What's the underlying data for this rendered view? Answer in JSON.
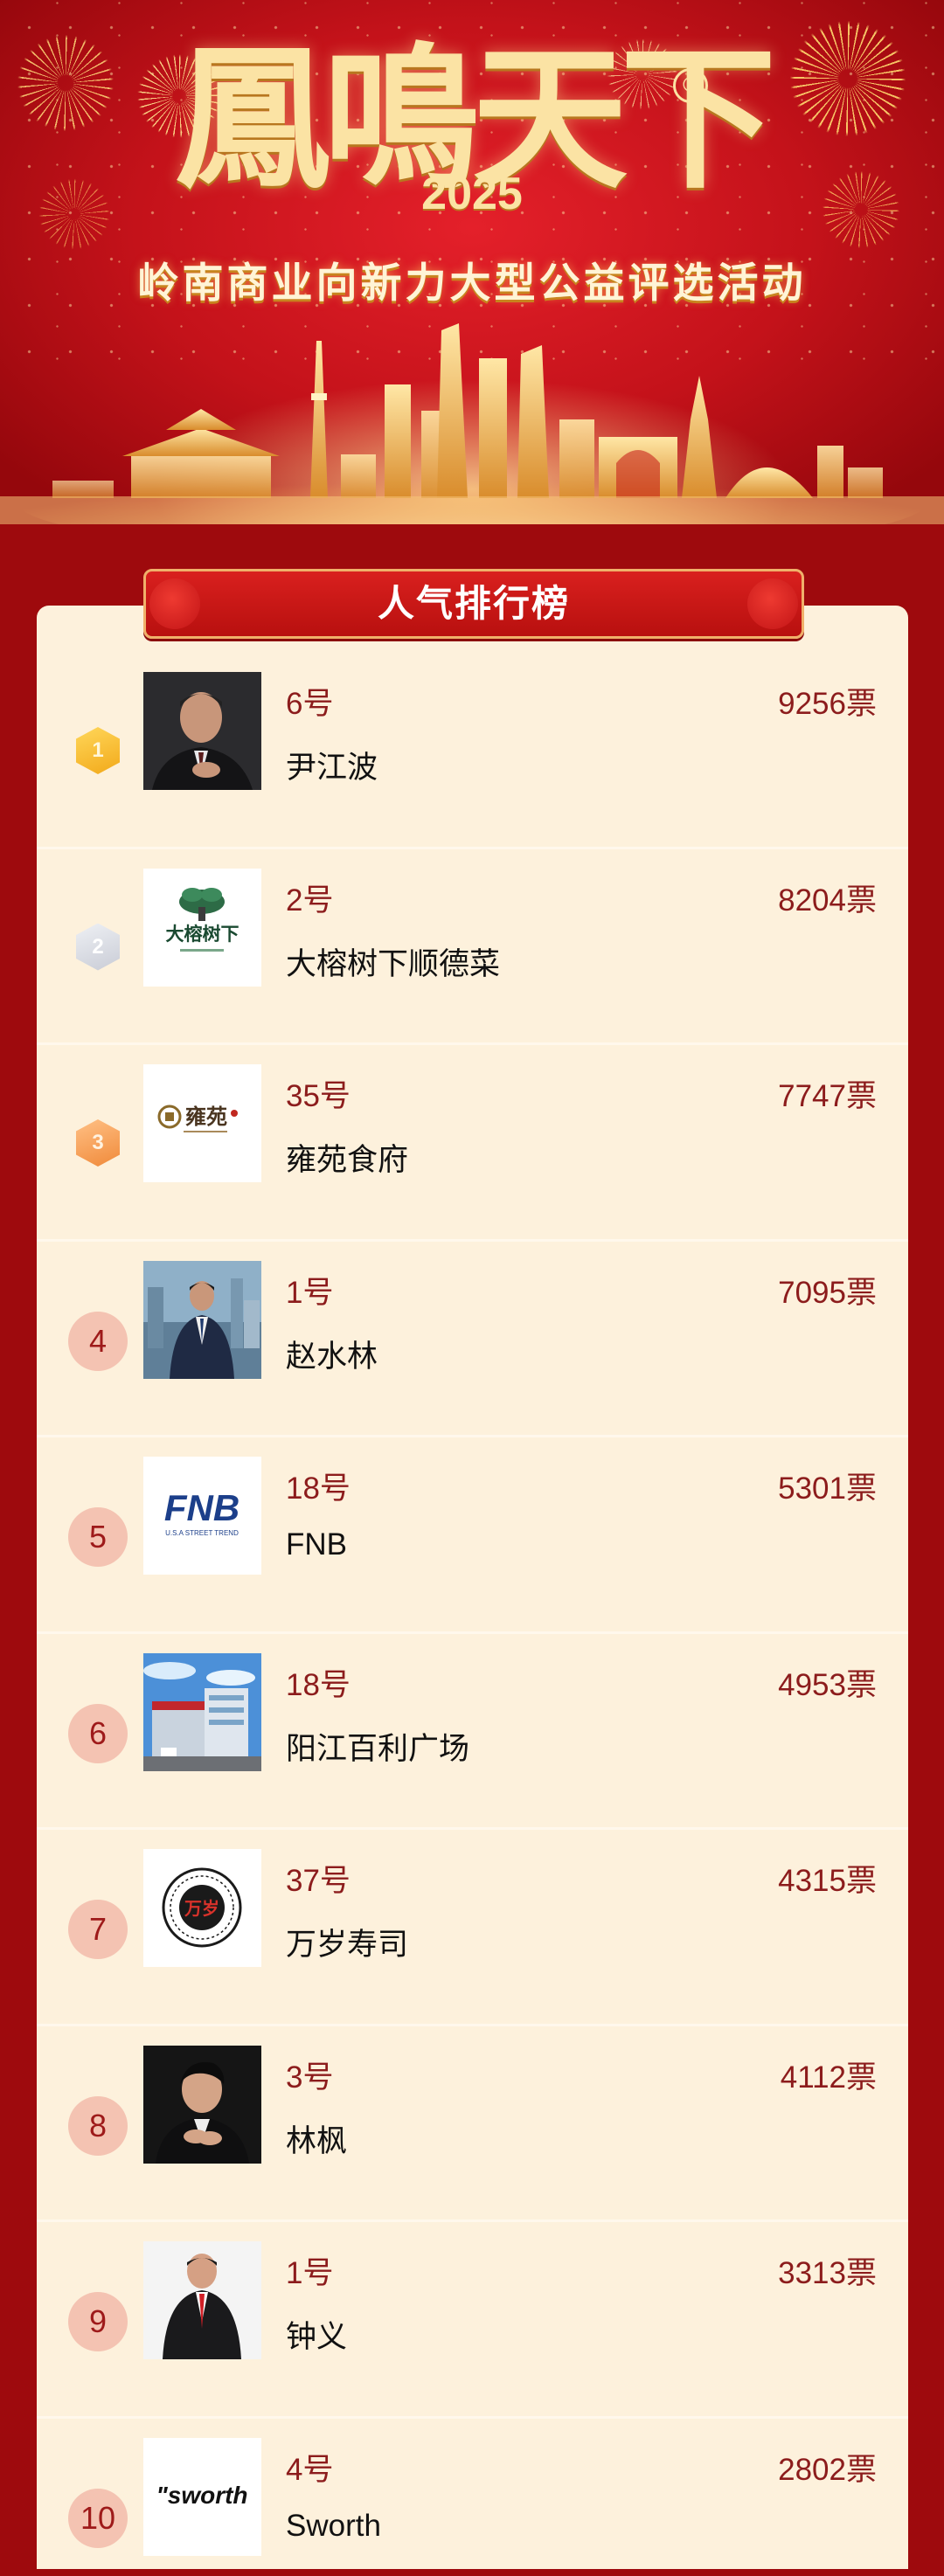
{
  "banner": {
    "logo_text": "鳳鳴天下",
    "registered_mark": "®",
    "year": "2025",
    "event_title": "岭南商业向新力大型公益评选活动"
  },
  "ranking": {
    "title": "人气排行榜",
    "entries": [
      {
        "rank": "1",
        "number": "6号",
        "name": "尹江波",
        "votes": "9256票"
      },
      {
        "rank": "2",
        "number": "2号",
        "name": "大榕树下顺德菜",
        "votes": "8204票"
      },
      {
        "rank": "3",
        "number": "35号",
        "name": "雍苑食府",
        "votes": "7747票"
      },
      {
        "rank": "4",
        "number": "1号",
        "name": "赵水林",
        "votes": "7095票"
      },
      {
        "rank": "5",
        "number": "18号",
        "name": "FNB",
        "votes": "5301票"
      },
      {
        "rank": "6",
        "number": "18号",
        "name": "阳江百利广场",
        "votes": "4953票"
      },
      {
        "rank": "7",
        "number": "37号",
        "name": "万岁寿司",
        "votes": "4315票"
      },
      {
        "rank": "8",
        "number": "3号",
        "name": "林枫",
        "votes": "4112票"
      },
      {
        "rank": "9",
        "number": "1号",
        "name": "钟义",
        "votes": "3313票"
      },
      {
        "rank": "10",
        "number": "4号",
        "name": "Sworth",
        "votes": "2802票"
      }
    ]
  },
  "logos": {
    "dashuxia_text": "大榕树下",
    "yongyuan_text": "雍苑",
    "fnb_text": "FNB",
    "fnb_sub": "U.S.A STREET TREND",
    "wansui_text": "万岁",
    "sworth_text": "\"sworth"
  },
  "colors": {
    "background": "#9e0a0d",
    "card": "#fdf1dc",
    "accent_red": "#8c1c1c",
    "gold": "#fbe3a4",
    "medal_gold": "#f2a91a",
    "medal_silver": "#c9ccd6",
    "medal_bronze": "#f08a3a",
    "rank_circle": "#f4c3b2"
  }
}
